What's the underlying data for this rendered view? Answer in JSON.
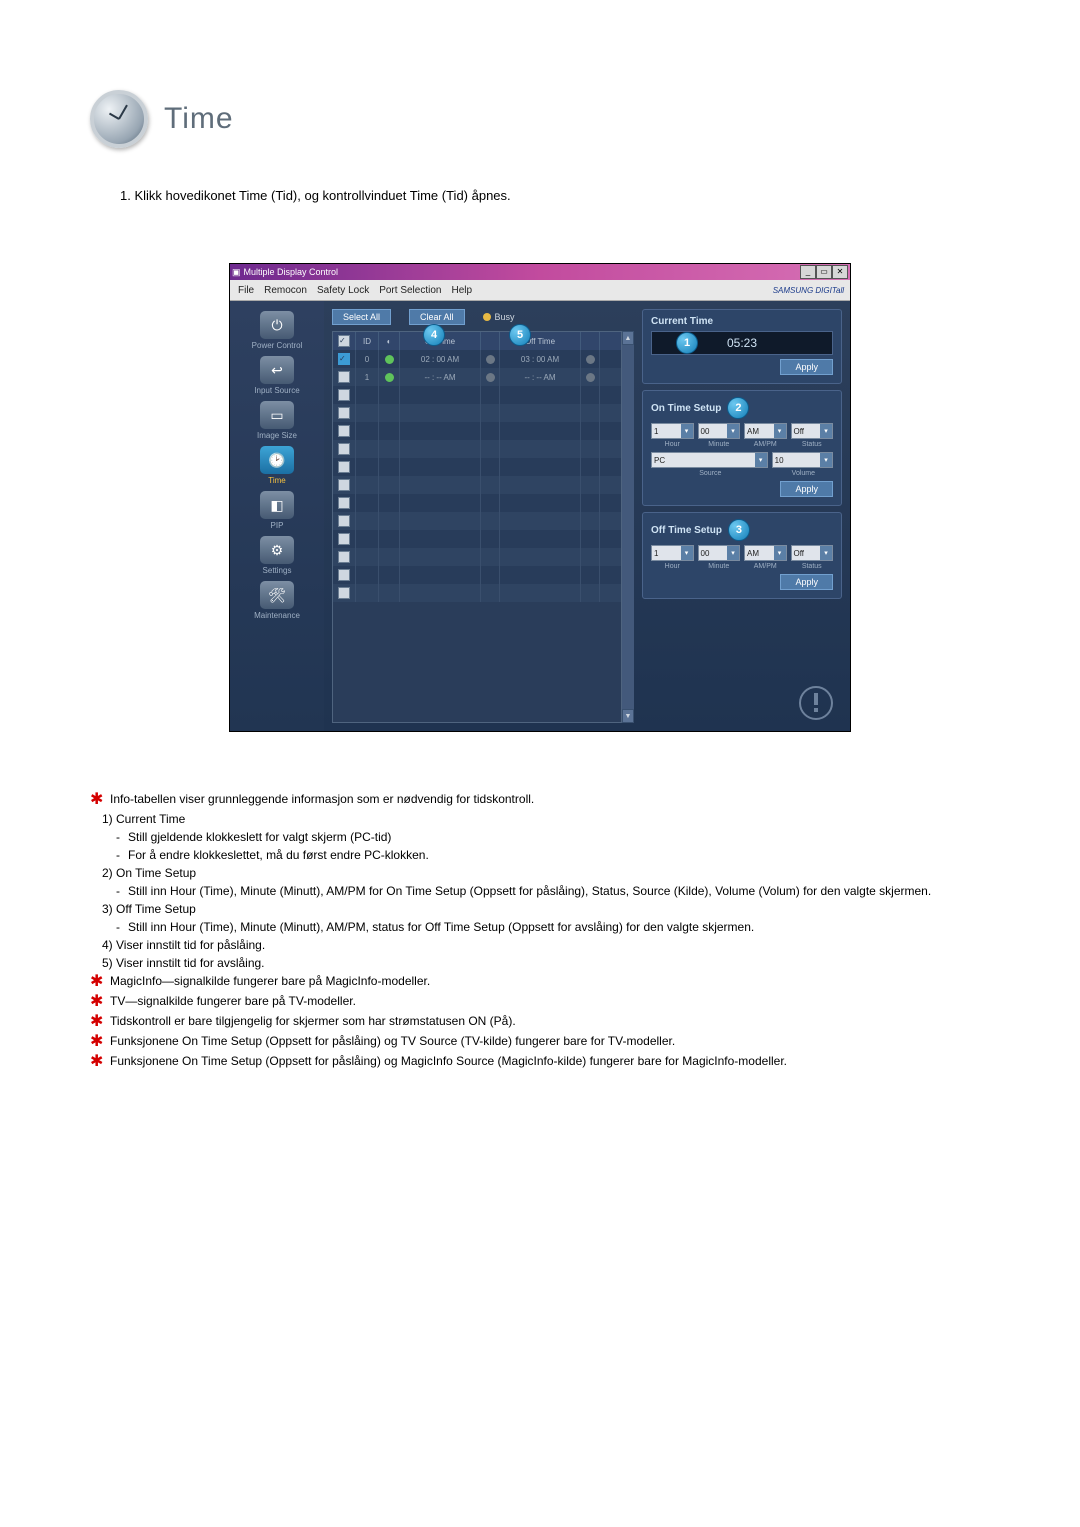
{
  "heading": "Time",
  "intro": "1.  Klikk hovedikonet Time (Tid), og kontrollvinduet Time (Tid) åpnes.",
  "window": {
    "title": "Multiple Display Control",
    "menu": [
      "File",
      "Remocon",
      "Safety Lock",
      "Port Selection",
      "Help"
    ],
    "brand": "SAMSUNG DIGITall",
    "buttons": {
      "selectAll": "Select All",
      "clearAll": "Clear All",
      "busy": "Busy"
    },
    "gridHeaders": {
      "chk": "✓",
      "id": "ID",
      "status": "",
      "onTime": "On Time",
      "st1": "",
      "offTime": "Off Time",
      "st2": ""
    },
    "rows": [
      {
        "id": "0",
        "onTime": "02 : 00 AM",
        "offTime": "03 : 00 AM",
        "led": "green",
        "checked": true,
        "st": "gray"
      },
      {
        "id": "1",
        "onTime": "-- : -- AM",
        "offTime": "-- : -- AM",
        "led": "green",
        "checked": false,
        "st": "gray"
      },
      {
        "id": ""
      },
      {
        "id": ""
      },
      {
        "id": ""
      },
      {
        "id": ""
      },
      {
        "id": ""
      },
      {
        "id": ""
      },
      {
        "id": ""
      },
      {
        "id": ""
      },
      {
        "id": ""
      },
      {
        "id": ""
      },
      {
        "id": ""
      },
      {
        "id": ""
      }
    ],
    "panels": {
      "currentTime": {
        "title": "Current Time",
        "value": "05:23",
        "apply": "Apply"
      },
      "onTimeSetup": {
        "title": "On Time Setup",
        "hour": "1",
        "minute": "00",
        "ampm": "AM",
        "status": "Off",
        "source": "PC",
        "volume": "10",
        "labels": {
          "hour": "Hour",
          "minute": "Minute",
          "ampm": "AM/PM",
          "status": "Status",
          "source": "Source",
          "volume": "Volume"
        },
        "apply": "Apply"
      },
      "offTimeSetup": {
        "title": "Off Time Setup",
        "hour": "1",
        "minute": "00",
        "ampm": "AM",
        "status": "Off",
        "labels": {
          "hour": "Hour",
          "minute": "Minute",
          "ampm": "AM/PM",
          "status": "Status"
        },
        "apply": "Apply"
      }
    },
    "markers": {
      "m1": "1",
      "m2": "2",
      "m3": "3",
      "m4": "4",
      "m5": "5"
    },
    "sidebar": [
      {
        "label": "Power Control"
      },
      {
        "label": "Input Source"
      },
      {
        "label": "Image Size"
      },
      {
        "label": "Time",
        "active": true
      },
      {
        "label": "PIP"
      },
      {
        "label": "Settings"
      },
      {
        "label": "Maintenance"
      }
    ]
  },
  "notes": {
    "star1": "Info-tabellen viser grunnleggende informasjon som er nødvendig for tidskontroll.",
    "n1_title": "1)  Current Time",
    "n1_a": "Still gjeldende klokkeslett for valgt skjerm (PC-tid)",
    "n1_b": "For å endre klokkeslettet, må du først endre PC-klokken.",
    "n2_title": "2)  On Time Setup",
    "n2_a": "Still inn Hour (Time), Minute (Minutt), AM/PM for On Time Setup (Oppsett for påslåing), Status, Source (Kilde), Volume (Volum) for den valgte skjermen.",
    "n3_title": "3)  Off Time Setup",
    "n3_a": "Still inn Hour (Time), Minute (Minutt), AM/PM, status for Off Time Setup (Oppsett for avslåing) for den valgte skjermen.",
    "n4": "4)  Viser innstilt tid for påslåing.",
    "n5": "5)  Viser innstilt tid for avslåing.",
    "star2": "MagicInfo—signalkilde fungerer bare på MagicInfo-modeller.",
    "star3": "TV—signalkilde fungerer bare på TV-modeller.",
    "star4": "Tidskontroll er bare tilgjengelig for skjermer som har strømstatusen ON (På).",
    "star5": "Funksjonene On Time Setup (Oppsett for påslåing) og TV Source (TV-kilde) fungerer bare for TV-modeller.",
    "star6": "Funksjonene On Time Setup (Oppsett for påslåing) og MagicInfo Source (MagicInfo-kilde) fungerer bare for MagicInfo-modeller."
  }
}
